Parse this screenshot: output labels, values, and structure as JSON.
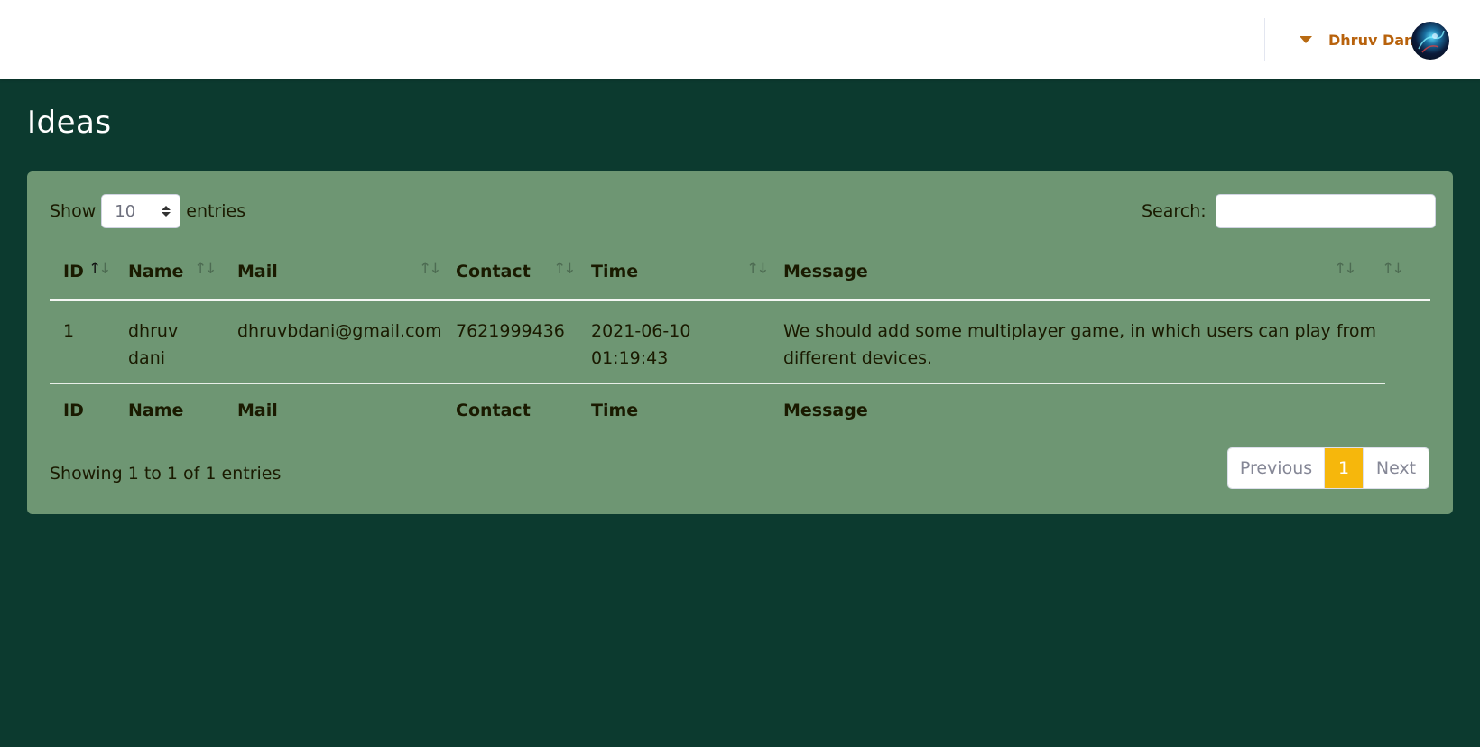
{
  "topbar": {
    "user_name": "Dhruv Dani"
  },
  "page": {
    "title": "Ideas"
  },
  "table_controls": {
    "show_label": "Show",
    "entries_value": "10",
    "entries_label": "entries",
    "search_label": "Search:",
    "search_value": ""
  },
  "table": {
    "columns": [
      "ID",
      "Name",
      "Mail",
      "Contact",
      "Time",
      "Message"
    ],
    "rows": [
      {
        "id": "1",
        "name_line1": "dhruv",
        "name_line2": "dani",
        "mail": "dhruvbdani@gmail.com",
        "contact": "7621999436",
        "time_line1": "2021-06-10",
        "time_line2": "01:19:43",
        "message_line1": "We should add some multiplayer game, in which users can play from",
        "message_line2": "different devices."
      }
    ],
    "sort_glyphs": {
      "up": "↑",
      "down": "↓"
    }
  },
  "footer": {
    "info": "Showing 1 to 1 of 1 entries",
    "prev_label": "Previous",
    "page_label": "1",
    "next_label": "Next"
  },
  "colors": {
    "background": "#0c3a2f",
    "card": "#6e9673",
    "accent": "#f6b70c",
    "user_name": "#b8620c"
  }
}
